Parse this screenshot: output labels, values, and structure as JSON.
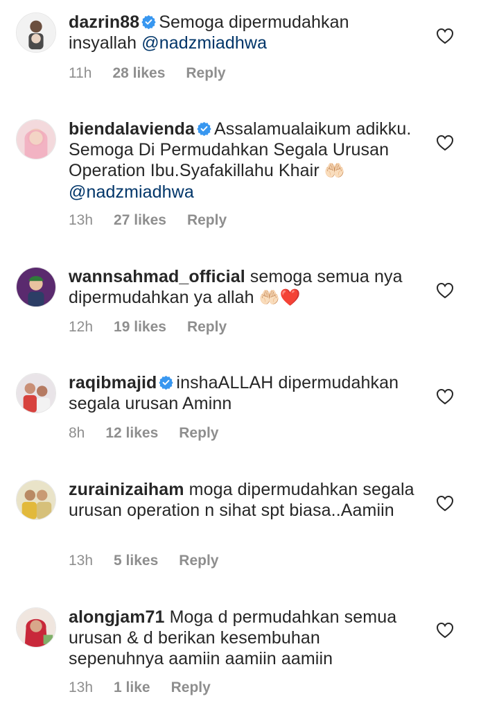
{
  "comments": [
    {
      "username": "dazrin88",
      "verified": true,
      "text": "Semoga dipermudahkan insyallah ",
      "mention": "@nadzmiadhwa",
      "emoji": "",
      "time": "11h",
      "likes": "28 likes",
      "reply": "Reply"
    },
    {
      "username": "biendalavienda",
      "verified": true,
      "text": "Assalamualaikum adikku. Semoga Di Permudahkan Segala Urusan Operation Ibu.Syafakillahu Khair ",
      "mention": "@nadzmiadhwa",
      "emoji": "🤲🏻",
      "time": "13h",
      "likes": "27 likes",
      "reply": "Reply"
    },
    {
      "username": "wannsahmad_official",
      "verified": false,
      "text": "semoga semua nya dipermudahkan ya allah ",
      "mention": "",
      "emoji": "🤲🏻❤️",
      "time": "12h",
      "likes": "19 likes",
      "reply": "Reply"
    },
    {
      "username": "raqibmajid",
      "verified": true,
      "text": "inshaALLAH dipermudahkan segala urusan Aminn",
      "mention": "",
      "emoji": "",
      "time": "8h",
      "likes": "12 likes",
      "reply": "Reply"
    },
    {
      "username": "zurainizaiham",
      "verified": false,
      "text": "moga dipermudahkan segala urusan operation n sihat spt biasa..Aamiin",
      "mention": "",
      "emoji": "",
      "time": "13h",
      "likes": "5 likes",
      "reply": "Reply"
    },
    {
      "username": "alongjam71",
      "verified": false,
      "text": "Moga d permudahkan semua urusan & d berikan kesembuhan sepenuhnya aamiin aamiin aamiin",
      "mention": "",
      "emoji": "",
      "time": "13h",
      "likes": "1 like",
      "reply": "Reply"
    }
  ],
  "icons": {
    "verified": "verified-badge-icon",
    "like": "heart-outline-icon"
  },
  "colors": {
    "text": "#262626",
    "meta": "#8e8e8e",
    "mention": "#003569",
    "verified": "#3897f0",
    "heart_stroke": "#262626"
  }
}
